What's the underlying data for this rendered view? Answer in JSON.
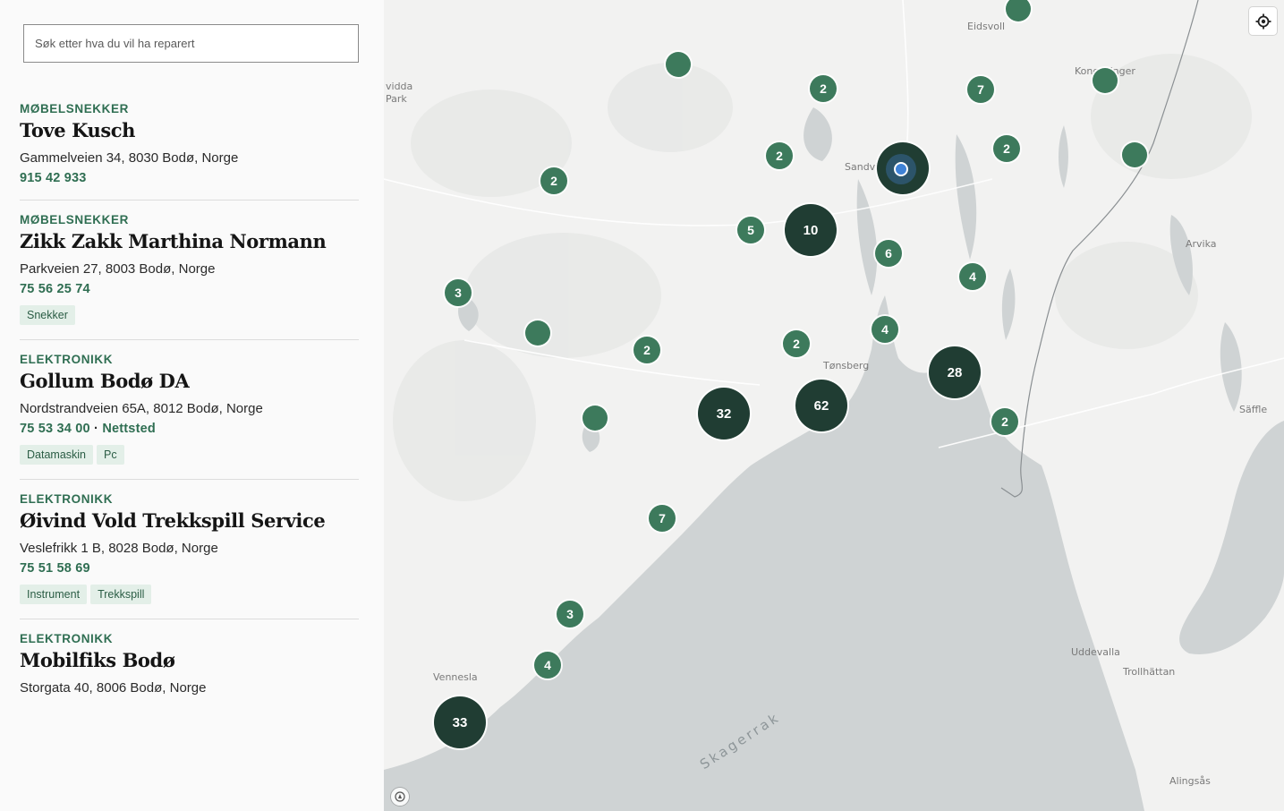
{
  "search": {
    "placeholder": "Søk etter hva du vil ha reparert"
  },
  "listings": [
    {
      "category": "MØBELSNEKKER",
      "name": "Tove Kusch",
      "address": "Gammelveien 34, 8030 Bodø, Norge",
      "phone": "915 42 933",
      "website": "",
      "tags": []
    },
    {
      "category": "MØBELSNEKKER",
      "name": "Zikk Zakk Marthina Normann",
      "address": "Parkveien 27, 8003 Bodø, Norge",
      "phone": "75 56 25 74",
      "website": "",
      "tags": [
        "Snekker"
      ]
    },
    {
      "category": "ELEKTRONIKK",
      "name": "Gollum Bodø DA",
      "address": "Nordstrandveien 65A, 8012 Bodø, Norge",
      "phone": "75 53 34 00",
      "website": "Nettsted",
      "tags": [
        "Datamaskin",
        "Pc"
      ]
    },
    {
      "category": "ELEKTRONIKK",
      "name": "Øivind Vold Trekkspill Service",
      "address": "Veslefrikk 1 B, 8028 Bodø, Norge",
      "phone": "75 51 58 69",
      "website": "",
      "tags": [
        "Instrument",
        "Trekkspill"
      ]
    },
    {
      "category": "ELEKTRONIKK",
      "name": "Mobilfiks Bodø",
      "address": "Storgata 40, 8006 Bodø, Norge",
      "phone": "",
      "website": "",
      "tags": []
    }
  ],
  "map": {
    "places": [
      "Eidsvoll",
      "Kongsvinger",
      "Sandvika",
      "Arvika",
      "Tønsberg",
      "Säffle",
      "Uddevalla",
      "Trollhättan",
      "Vennesla",
      "Alingsås",
      "vidda",
      "Park"
    ],
    "sea_label": "Skagerrak",
    "clusters": [
      "2",
      "7",
      "2",
      "2",
      "2",
      "5",
      "10",
      "6",
      "4",
      "3",
      "2",
      "2",
      "4",
      "28",
      "32",
      "62",
      "2",
      "7",
      "3",
      "4",
      "33",
      "",
      "",
      "",
      "",
      "",
      ""
    ],
    "colors": {
      "cluster_small": "#3d7a5c",
      "cluster_large": "#203d33",
      "water": "#cfd3d4",
      "land": "#f2f2f1",
      "accent": "#2f6e52"
    }
  }
}
